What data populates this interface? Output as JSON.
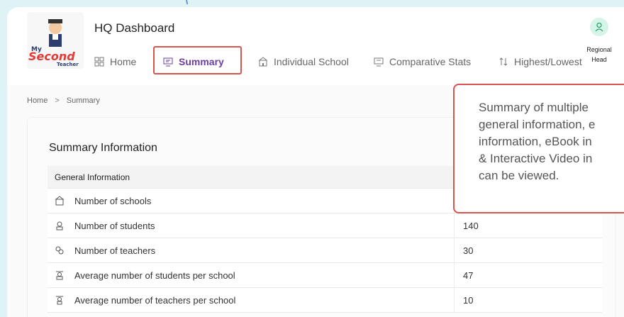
{
  "app": {
    "title": "HQ Dashboard",
    "logo_text": "My Second Teacher"
  },
  "nav": {
    "items": [
      {
        "label": "Home",
        "icon": "grid-icon"
      },
      {
        "label": "Summary",
        "icon": "monitor-icon",
        "active": true
      },
      {
        "label": "Individual School",
        "icon": "school-icon"
      },
      {
        "label": "Comparative Stats",
        "icon": "monitor-icon"
      },
      {
        "label": "Highest/Lowest",
        "icon": "sort-icon"
      }
    ]
  },
  "user": {
    "role_line1": "Regional",
    "role_line2": "Head"
  },
  "breadcrumb": {
    "home": "Home",
    "separator": ">",
    "current": "Summary"
  },
  "summary": {
    "title": "Summary Information",
    "table_header": "General Information",
    "rows": [
      {
        "label": "Number of schools",
        "value": "",
        "icon": "school-icon"
      },
      {
        "label": "Number of students",
        "value": "140",
        "icon": "student-icon"
      },
      {
        "label": "Number of teachers",
        "value": "30",
        "icon": "teachers-icon"
      },
      {
        "label": "Average number of students per school",
        "value": "47",
        "icon": "student-icon"
      },
      {
        "label": "Average number of teachers per school",
        "value": "10",
        "icon": "teacher-icon"
      }
    ]
  },
  "tooltip": {
    "text": "Summary of multiple\ngeneral information, e\ninformation, eBook in\n& Interactive Video in\ncan be viewed."
  },
  "colors": {
    "accent": "#6b3fa0",
    "highlight": "#d9534f",
    "background": "#dff3f6"
  }
}
